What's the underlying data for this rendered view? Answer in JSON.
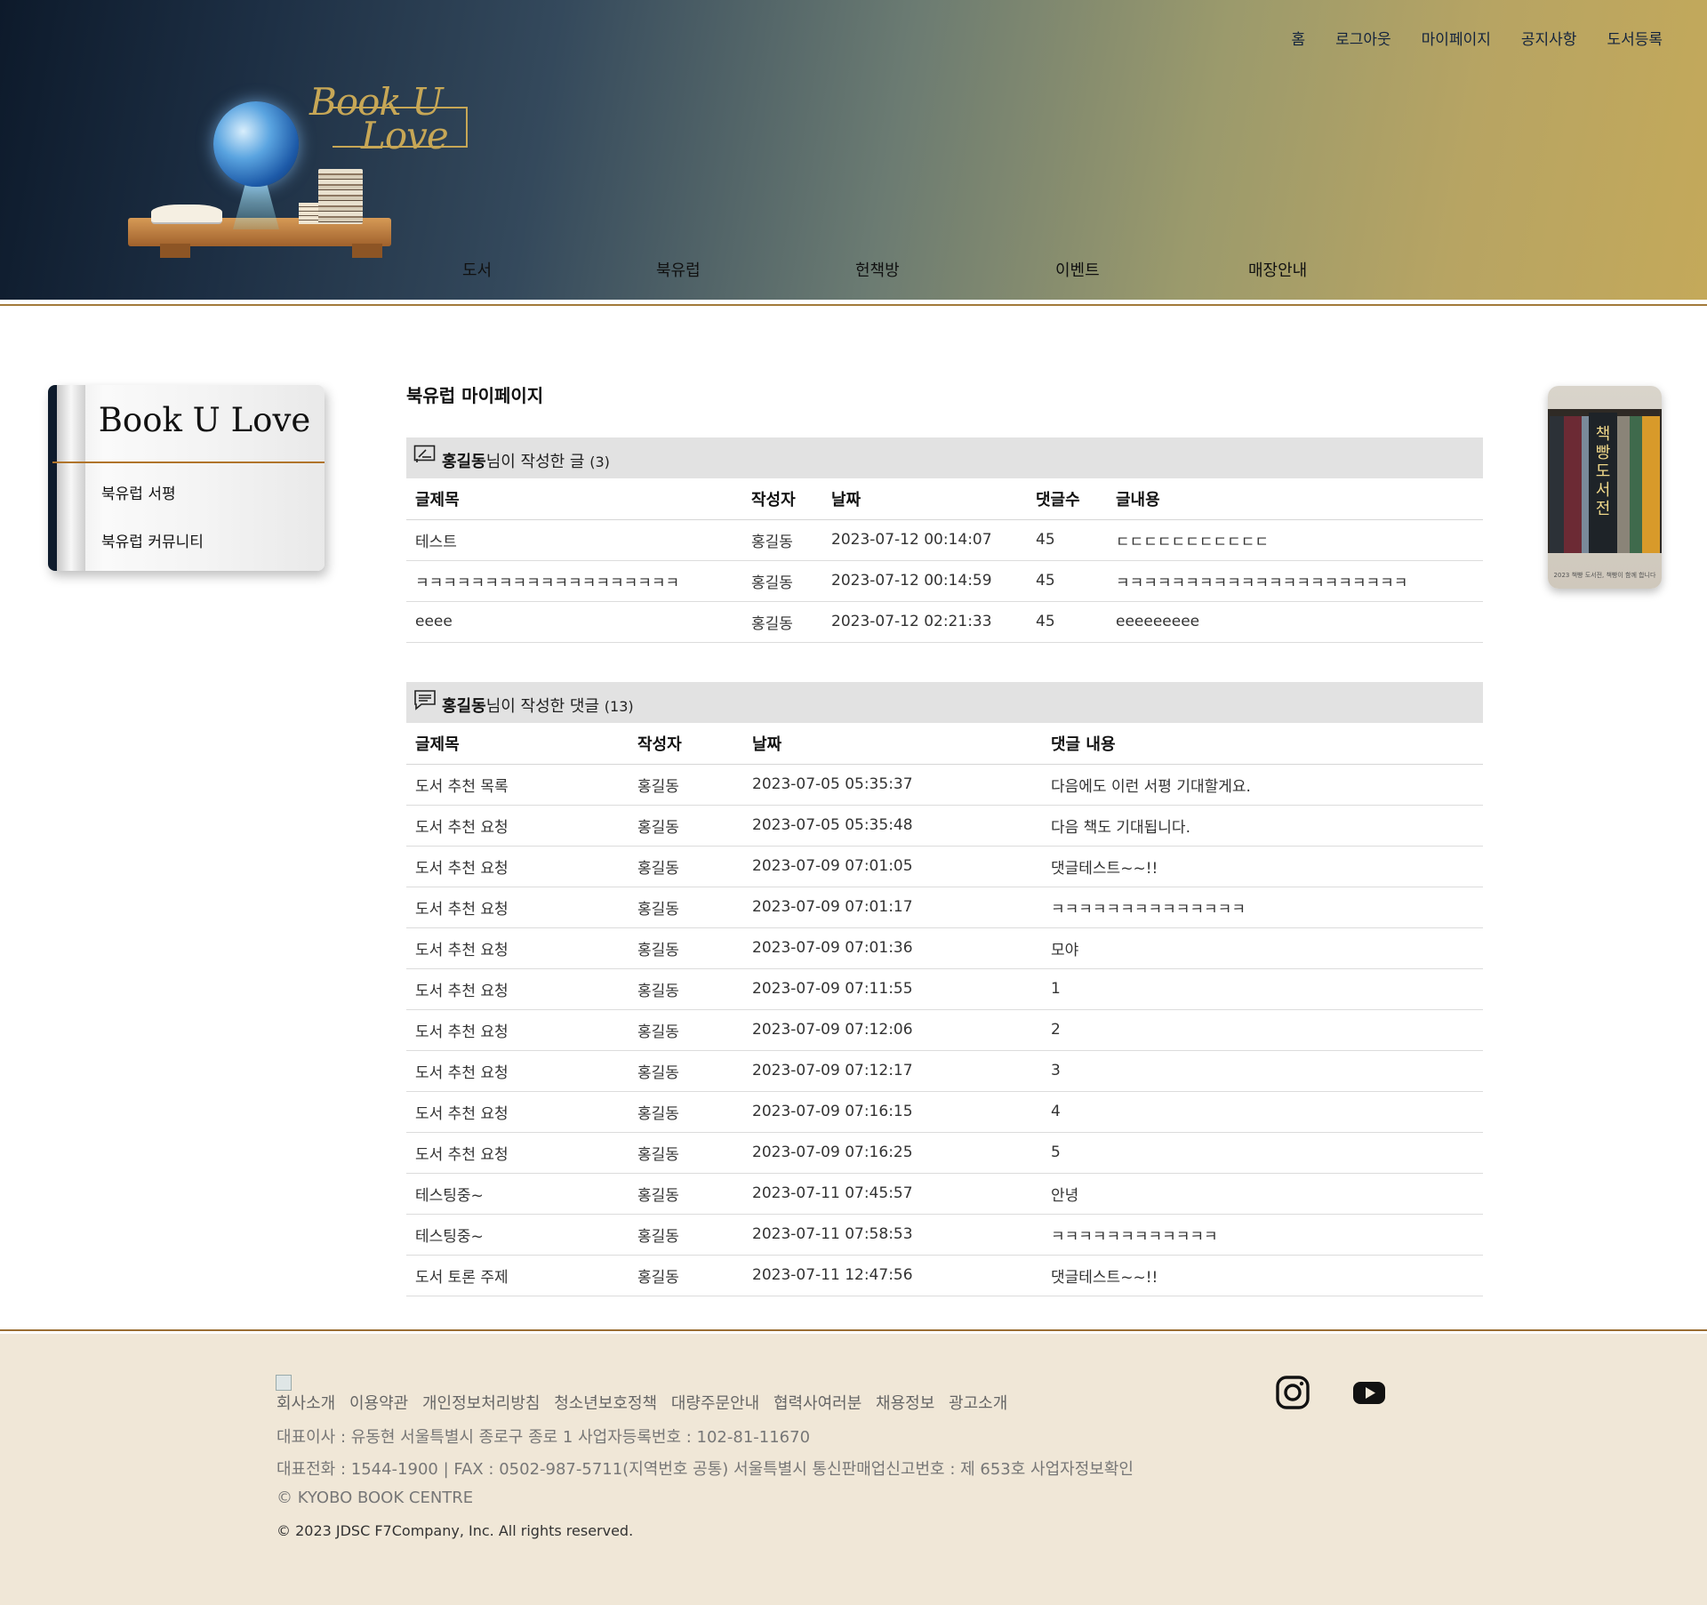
{
  "top_nav": [
    "홈",
    "로그아웃",
    "마이페이지",
    "공지사항",
    "도서등록"
  ],
  "brand": {
    "line1": "Book U",
    "line2": "Love"
  },
  "main_nav": [
    "도서",
    "북유럽",
    "헌책방",
    "이벤트",
    "매장안내"
  ],
  "sidebar": {
    "title": "Book U Love",
    "items": [
      "북유럽 서평",
      "북유럽 커뮤니티"
    ]
  },
  "promo": {
    "vertical_text": "책빵도서전",
    "caption": "2023 책빵 도서전, 책빵이 함께 합니다"
  },
  "content": {
    "page_title": "북유럽 마이페이지",
    "posts": {
      "user": "홍길동",
      "label": "님이 작성한 글",
      "count": "(3)",
      "columns": [
        "글제목",
        "작성자",
        "날짜",
        "댓글수",
        "글내용"
      ],
      "rows": [
        [
          "테스트",
          "홍길동",
          "2023-07-12 00:14:07",
          "45",
          "ㄷㄷㄷㄷㄷㄷㄷㄷㄷㄷㄷ"
        ],
        [
          "ㅋㅋㅋㅋㅋㅋㅋㅋㅋㅋㅋㅋㅋㅋㅋㅋㅋㅋㅋ",
          "홍길동",
          "2023-07-12 00:14:59",
          "45",
          "ㅋㅋㅋㅋㅋㅋㅋㅋㅋㅋㅋㅋㅋㅋㅋㅋㅋㅋㅋㅋㅋ"
        ],
        [
          "eeee",
          "홍길동",
          "2023-07-12 02:21:33",
          "45",
          "eeeeeeeee"
        ]
      ]
    },
    "comments": {
      "user": "홍길동",
      "label": "님이 작성한 댓글",
      "count": "(13)",
      "columns": [
        "글제목",
        "작성자",
        "날짜",
        "댓글 내용"
      ],
      "rows": [
        [
          "도서 추천 목록",
          "홍길동",
          "2023-07-05 05:35:37",
          "다음에도 이런 서평 기대할게요."
        ],
        [
          "도서 추천 요청",
          "홍길동",
          "2023-07-05 05:35:48",
          "다음 책도 기대됩니다."
        ],
        [
          "도서 추천 요청",
          "홍길동",
          "2023-07-09 07:01:05",
          "댓글테스트~~!!"
        ],
        [
          "도서 추천 요청",
          "홍길동",
          "2023-07-09 07:01:17",
          "ㅋㅋㅋㅋㅋㅋㅋㅋㅋㅋㅋㅋㅋㅋ"
        ],
        [
          "도서 추천 요청",
          "홍길동",
          "2023-07-09 07:01:36",
          "모야"
        ],
        [
          "도서 추천 요청",
          "홍길동",
          "2023-07-09 07:11:55",
          "1"
        ],
        [
          "도서 추천 요청",
          "홍길동",
          "2023-07-09 07:12:06",
          "2"
        ],
        [
          "도서 추천 요청",
          "홍길동",
          "2023-07-09 07:12:17",
          "3"
        ],
        [
          "도서 추천 요청",
          "홍길동",
          "2023-07-09 07:16:15",
          "4"
        ],
        [
          "도서 추천 요청",
          "홍길동",
          "2023-07-09 07:16:25",
          "5"
        ],
        [
          "테스팅중~",
          "홍길동",
          "2023-07-11 07:45:57",
          "안녕"
        ],
        [
          "테스팅중~",
          "홍길동",
          "2023-07-11 07:58:53",
          "ㅋㅋㅋㅋㅋㅋㅋㅋㅋㅋㅋㅋ"
        ],
        [
          "도서 토론 주제",
          "홍길동",
          "2023-07-11 12:47:56",
          "댓글테스트~~!!"
        ]
      ]
    }
  },
  "footer": {
    "links": [
      "회사소개",
      "이용약관",
      "개인정보처리방침",
      "청소년보호정책",
      "대량주문안내",
      "협력사여러분",
      "채용정보",
      "광고소개"
    ],
    "line1": "대표이사 : 유동현 서울특별시 종로구 종로 1 사업자등록번호 : 102-81-11670",
    "line2": "대표전화 : 1544-1900 | FAX : 0502-987-5711(지역번호 공통) 서울특별시 통신판매업신고번호 : 제 653호 사업자정보확인",
    "line3": "© KYOBO BOOK CENTRE",
    "line4": "© 2023 JDSC F7Company, Inc. All rights reserved.",
    "social": [
      "instagram-icon",
      "youtube-icon"
    ]
  }
}
